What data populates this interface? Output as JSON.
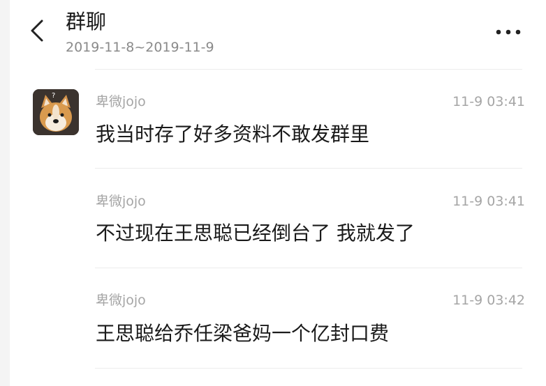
{
  "header": {
    "title": "群聊",
    "date_range": "2019-11-8~2019-11-9",
    "back_icon": "chevron-left-icon",
    "more_icon": "more-dots-icon"
  },
  "messages": [
    {
      "sender": "卑微jojo",
      "time": "11-9 03:41",
      "text": "我当时存了好多资料不敢发群里"
    },
    {
      "sender": "卑微jojo",
      "time": "11-9 03:41",
      "text": "不过现在王思聪已经倒台了 我就发了"
    },
    {
      "sender": "卑微jojo",
      "time": "11-9 03:42",
      "text": "王思聪给乔任梁爸妈一个亿封口费"
    }
  ],
  "colors": {
    "background": "#ffffff",
    "primary_text": "#1a1a1a",
    "secondary_text": "#a5a5a5",
    "divider": "#ececec"
  }
}
